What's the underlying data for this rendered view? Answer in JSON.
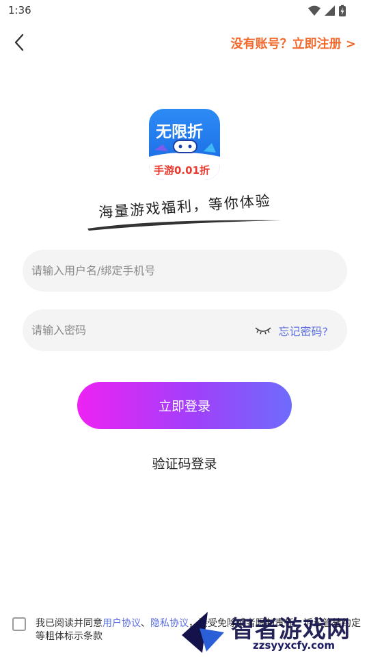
{
  "status_bar": {
    "time": "1:36"
  },
  "nav": {
    "register_text": "没有账号？立即注册 >"
  },
  "logo": {
    "title": "无限折",
    "subtitle": "手游0.01折"
  },
  "slogan": "海量游戏福利，等你体验",
  "username": {
    "placeholder": "请输入用户名/绑定手机号",
    "value": ""
  },
  "password": {
    "placeholder": "请输入密码",
    "value": "",
    "forgot_label": "忘记密码?"
  },
  "login_button": "立即登录",
  "sms_login": "验证码登录",
  "agreement": {
    "prefix": "我已阅读并同意",
    "link_user": "用户协议",
    "sep": "、",
    "link_privacy": "隐私协议",
    "suffix": "，接受免除或者限制责任、诉讼管辖约定等粗体标示条款"
  },
  "watermark": {
    "title": "智者游戏网",
    "url": "zzsyyxcfy.com"
  },
  "colors": {
    "accent_orange": "#f26a2e",
    "link_blue": "#5a6de0",
    "gradient_start": "#ee22f3",
    "gradient_end": "#6e6cfc"
  }
}
